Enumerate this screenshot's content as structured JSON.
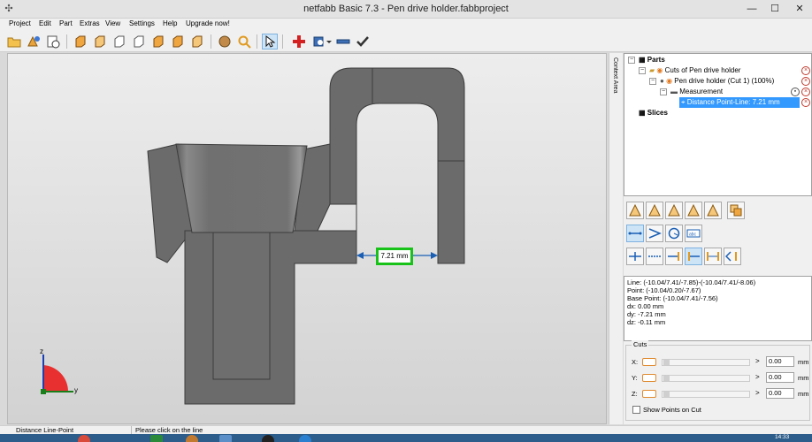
{
  "window": {
    "title": "netfabb Basic 7.3 - Pen drive holder.fabbproject",
    "minimize": "—",
    "maximize": "☐",
    "close": "✕"
  },
  "menu": [
    "Project",
    "Edit",
    "Part",
    "Extras",
    "View",
    "Settings",
    "Help",
    "Upgrade now!"
  ],
  "viewport": {
    "measurement_label": "7.21 mm",
    "axis_x": "y",
    "axis_z": "z"
  },
  "context_tab": "Context Area",
  "tree": {
    "parts": "Parts",
    "cuts_of": "Cuts of Pen drive holder",
    "part": "Pen drive holder (Cut 1) (100%)",
    "measurement": "Measurement",
    "distance": "Distance Point-Line: 7.21 mm",
    "slices": "Slices"
  },
  "info_lines": [
    "Line: (-10.04/7.41/-7.85)-(-10.04/7.41/-8.06)",
    "Point: (-10.04/0.20/-7.67)",
    "Base Point: (-10.04/7.41/-7.56)",
    "dx: 0.00 mm",
    "dy: -7.21 mm",
    "dz: -0.11 mm"
  ],
  "cuts": {
    "title": "Cuts",
    "rows": [
      {
        "axis": "X:",
        "value": "0.00",
        "unit": "mm"
      },
      {
        "axis": "Y:",
        "value": "0.00",
        "unit": "mm"
      },
      {
        "axis": "Z:",
        "value": "0.00",
        "unit": "mm"
      }
    ],
    "show_points": "Show Points on Cut"
  },
  "status": {
    "left": "Distance Line-Point",
    "right": "Please click on the line"
  },
  "taskbar": {
    "clock": "14:33"
  },
  "colors": {
    "model": "#6b6b6b",
    "measure_box": "#19c219",
    "measure_arrow": "#1a5fb4",
    "selection": "#3399ff"
  }
}
